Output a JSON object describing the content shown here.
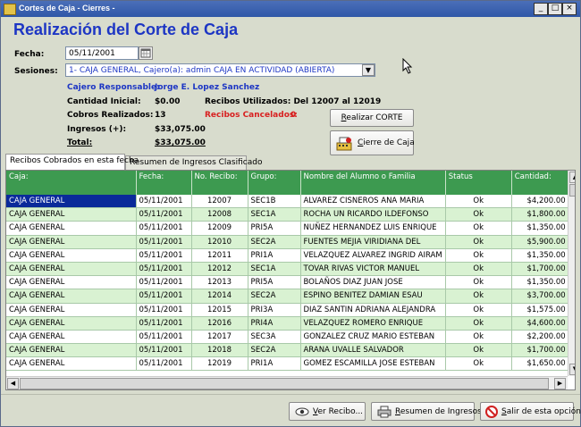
{
  "window": {
    "title": "Cortes de Caja - Cierres -",
    "min": "_",
    "max": "□",
    "close": "×"
  },
  "heading": "Realización del Corte de Caja",
  "form": {
    "fecha_label": "Fecha:",
    "fecha_value": "05/11/2001",
    "sesiones_label": "Sesiones:",
    "sesiones_value": "1- CAJA GENERAL, Cajero(a): admin   CAJA EN ACTIVIDAD (ABIERTA)",
    "cajero_label": "Cajero Responsable:",
    "cajero_value": "Jorge E. Lopez Sanchez",
    "cantidad_label": "Cantidad Inicial:",
    "cantidad_value": "$0.00",
    "recibos_utilizados": "Recibos Utilizados: Del 12007 al 12019",
    "cobros_label": "Cobros Realizados:",
    "cobros_value": "13",
    "cancelados_label": "Recibos Cancelados:",
    "cancelados_value": "0",
    "ingresos_label": "Ingresos (+):",
    "ingresos_value": "$33,075.00",
    "total_label": "Total:",
    "total_value": "$33,075.00"
  },
  "buttons": {
    "realizar_pre": "R",
    "realizar_rest": "ealizar CORTE",
    "cierre_pre": "C",
    "cierre_rest": "ierre de Caja",
    "ver_pre": "V",
    "ver_rest": "er Recibo...",
    "resumen_pre": "R",
    "resumen_rest": "esumen de Ingresos",
    "salir_pre": "S",
    "salir_rest": "alir de esta opción"
  },
  "tabs": [
    "Recibos Cobrados en esta fecha",
    "Resumen de Ingresos Clasificado"
  ],
  "grid": {
    "columns": [
      "Caja:",
      "Fecha:",
      "No. Recibo:",
      "Grupo:",
      "Nombre del Alumno o Familia",
      "Status",
      "Cantidad:"
    ],
    "rows": [
      [
        "CAJA GENERAL",
        "05/11/2001",
        "12007",
        "SEC1B",
        "ALVAREZ  CISNEROS ANA MARIA",
        "Ok",
        "$4,200.00"
      ],
      [
        "CAJA GENERAL",
        "05/11/2001",
        "12008",
        "SEC1A",
        "ROCHA UN RICARDO ILDEFONSO",
        "Ok",
        "$1,800.00"
      ],
      [
        "CAJA GENERAL",
        "05/11/2001",
        "12009",
        "PRI5A",
        "NUÑEZ HERNANDEZ LUIS ENRIQUE",
        "Ok",
        "$1,350.00"
      ],
      [
        "CAJA GENERAL",
        "05/11/2001",
        "12010",
        "SEC2A",
        "FUENTES MEJIA VIRIDIANA DEL",
        "Ok",
        "$5,900.00"
      ],
      [
        "CAJA GENERAL",
        "05/11/2001",
        "12011",
        "PRI1A",
        "VELAZQUEZ  ALVAREZ INGRID AIRAM",
        "Ok",
        "$1,350.00"
      ],
      [
        "CAJA GENERAL",
        "05/11/2001",
        "12012",
        "SEC1A",
        "TOVAR RIVAS VICTOR MANUEL",
        "Ok",
        "$1,700.00"
      ],
      [
        "CAJA GENERAL",
        "05/11/2001",
        "12013",
        "PRI5A",
        "BOLAÑOS  DIAZ JUAN JOSE",
        "Ok",
        "$1,350.00"
      ],
      [
        "CAJA GENERAL",
        "05/11/2001",
        "12014",
        "SEC2A",
        "ESPINO BENITEZ DAMIAN ESAU",
        "Ok",
        "$3,700.00"
      ],
      [
        "CAJA GENERAL",
        "05/11/2001",
        "12015",
        "PRI3A",
        "DIAZ  SANTIN ADRIANA ALEJANDRA",
        "Ok",
        "$1,575.00"
      ],
      [
        "CAJA GENERAL",
        "05/11/2001",
        "12016",
        "PRI4A",
        "VELAZQUEZ  ROMERO ENRIQUE",
        "Ok",
        "$4,600.00"
      ],
      [
        "CAJA GENERAL",
        "05/11/2001",
        "12017",
        "SEC3A",
        "GONZALEZ  CRUZ MARIO ESTEBAN",
        "Ok",
        "$2,200.00"
      ],
      [
        "CAJA GENERAL",
        "05/11/2001",
        "12018",
        "SEC2A",
        "ARANA  UVALLE SALVADOR",
        "Ok",
        "$1,700.00"
      ],
      [
        "CAJA GENERAL",
        "05/11/2001",
        "12019",
        "PRI1A",
        "GOMEZ ESCAMILLA JOSE ESTEBAN",
        "Ok",
        "$1,650.00"
      ]
    ]
  },
  "colors": {
    "heading": "#1d36c4",
    "header_bg": "#3d9a50",
    "row_alt": "#d9f2d2",
    "selected": "#0a2a9a",
    "cancel_red": "#d82020"
  }
}
